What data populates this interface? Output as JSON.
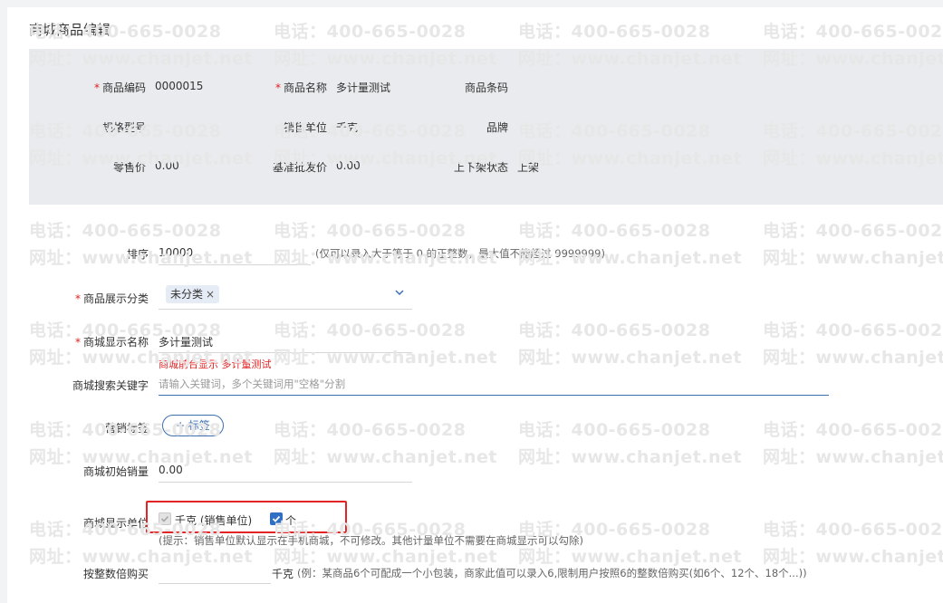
{
  "page_title": "商城商品编辑",
  "info": {
    "code": {
      "label": "商品编码",
      "value": "0000015"
    },
    "name": {
      "label": "商品名称",
      "value": "多计量测试"
    },
    "barcode": {
      "label": "商品条码",
      "value": ""
    },
    "spec": {
      "label": "规格型号",
      "value": ""
    },
    "sales_unit": {
      "label": "销售单位",
      "value": "千克"
    },
    "brand": {
      "label": "品牌",
      "value": ""
    },
    "retail_price": {
      "label": "零售价",
      "value": "0.00"
    },
    "wholesale_price": {
      "label": "基准批发价",
      "value": "0.00"
    },
    "shelf_status": {
      "label": "上下架状态",
      "value": "上架"
    }
  },
  "form": {
    "sort": {
      "label": "排序",
      "value": "10000",
      "hint": "(仅可以录入大于等于 0 的正整数，最大值不能超过 9999999)"
    },
    "category": {
      "label": "商品展示分类",
      "tag": "未分类",
      "remove": "×"
    },
    "display_name": {
      "label": "商城显示名称",
      "value": "多计量测试",
      "note": "商城前台显示 多计量测试"
    },
    "keywords": {
      "label": "商城搜索关键字",
      "placeholder": "请输入关键词，多个关键词用\"空格\"分割"
    },
    "marketing": {
      "label": "营销标签",
      "button": "+ 标签"
    },
    "initial_sales": {
      "label": "商城初始销量",
      "value": "0.00"
    },
    "display_units": {
      "label": "商城显示单位",
      "units": [
        {
          "label": "千克 (销售单位)",
          "checked": true,
          "disabled": true
        },
        {
          "label": "个",
          "checked": true,
          "disabled": false
        }
      ],
      "hint": "(提示：销售单位默认显示在手机商城，不可修改。其他计量单位不需要在商城显示可以勾除)"
    },
    "multiple_buy": {
      "label": "按整数倍购买",
      "unit": "千克",
      "hint": "(例：某商品6个可配成一个小包装，商家此值可以录入6,限制用户按照6的整数倍购买(如6个、12个、18个...))"
    }
  },
  "watermark": {
    "phone": "电话：400-665-0028",
    "site": "网址：www.chanjet.net"
  },
  "colors": {
    "accent": "#2f6fc4",
    "required": "#e02020",
    "highlight_box": "#e32424",
    "info_bg": "#e9ebee"
  }
}
